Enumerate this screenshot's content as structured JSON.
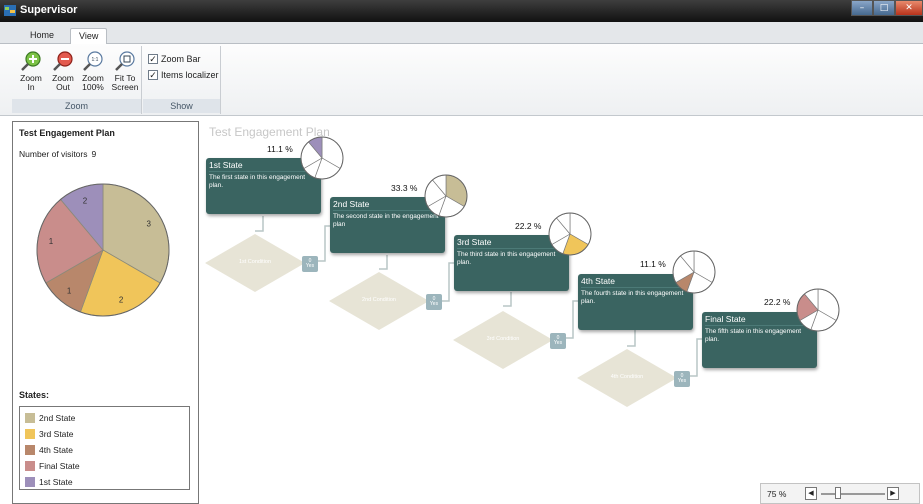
{
  "window": {
    "title": "Supervisor"
  },
  "tabs": [
    {
      "label": "Home"
    },
    {
      "label": "View"
    }
  ],
  "ribbon": {
    "zoom_group": {
      "label": "Zoom",
      "buttons": [
        {
          "label": "Zoom In"
        },
        {
          "label": "Zoom Out"
        },
        {
          "label": "Zoom 100%"
        },
        {
          "label": "Fit To Screen"
        }
      ]
    },
    "show_group": {
      "label": "Show",
      "checkboxes": [
        {
          "label": "Zoom Bar",
          "checked": true
        },
        {
          "label": "Items localizer",
          "checked": true
        }
      ]
    }
  },
  "left_panel": {
    "plan_title": "Test Engagement Plan",
    "visitors_label": "Number of visitors",
    "visitors_count": "9",
    "pie_labels": [
      "3",
      "2",
      "1",
      "1",
      "2"
    ],
    "states_label": "States:",
    "legend": [
      {
        "label": "2nd State",
        "color": "#c7bd96"
      },
      {
        "label": "3rd State",
        "color": "#f0c55a"
      },
      {
        "label": "4th State",
        "color": "#b8876b"
      },
      {
        "label": "Final State",
        "color": "#c98d8b"
      },
      {
        "label": "1st State",
        "color": "#9d8fba"
      }
    ]
  },
  "chart_data": {
    "type": "pie",
    "categories": [
      "2nd State",
      "3rd State",
      "4th State",
      "Final State",
      "1st State"
    ],
    "values": [
      3,
      2,
      1,
      2,
      1
    ],
    "colors": [
      "#c7bd96",
      "#f0c55a",
      "#b8876b",
      "#c98d8b",
      "#9d8fba"
    ]
  },
  "canvas": {
    "title": "Test Engagement Plan",
    "states": [
      {
        "name": "1st State",
        "description": "The first state in this engagement plan.",
        "percent": "11.1 %"
      },
      {
        "name": "2nd State",
        "description": "The second state in the engagement plan",
        "percent": "33.3 %"
      },
      {
        "name": "3rd State",
        "description": "The third state in this engagement plan.",
        "percent": "22.2 %"
      },
      {
        "name": "4th State",
        "description": "The fourth state in this engagement plan.",
        "percent": "11.1 %"
      },
      {
        "name": "Final State",
        "description": "The fifth state in this engagement plan.",
        "percent": "22.2 %"
      }
    ],
    "conditions": [
      {
        "label": "1st Condition",
        "badge_value": "0",
        "badge_text": "Yes"
      },
      {
        "label": "2nd Condition",
        "badge_value": "0",
        "badge_text": "Yes"
      },
      {
        "label": "3rd Condition",
        "badge_value": "0",
        "badge_text": "Yes"
      },
      {
        "label": "4th Condition",
        "badge_value": "0",
        "badge_text": "Yes"
      }
    ]
  },
  "zoombar": {
    "value": "75 %"
  },
  "icons": {
    "zoom_in": "zoom-in-icon",
    "zoom_out": "zoom-out-icon",
    "zoom_100": "zoom-100-icon",
    "fit_screen": "fit-to-screen-icon",
    "app": "app-icon"
  }
}
